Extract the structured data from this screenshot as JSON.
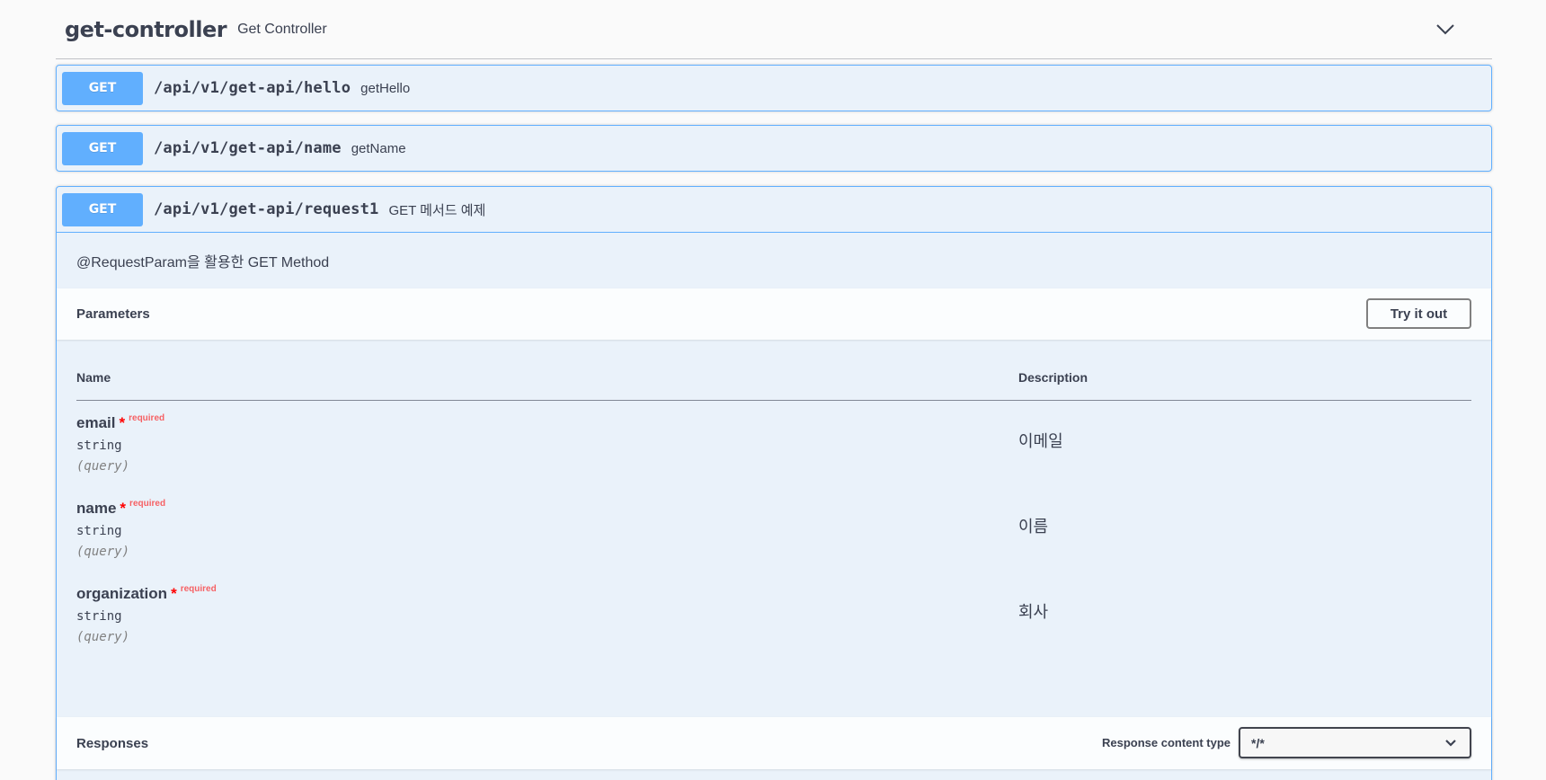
{
  "tag": {
    "name": "get-controller",
    "description": "Get Controller",
    "toggle_icon": "chevron-down-icon"
  },
  "operations": [
    {
      "method": "GET",
      "path": "/api/v1/get-api/hello",
      "summary": "getHello"
    },
    {
      "method": "GET",
      "path": "/api/v1/get-api/name",
      "summary": "getName"
    },
    {
      "method": "GET",
      "path": "/api/v1/get-api/request1",
      "summary": "GET 메서드 예제"
    }
  ],
  "expanded": {
    "description": "@RequestParam을 활용한 GET Method",
    "parameters_title": "Parameters",
    "try_it_out_label": "Try it out",
    "columns": {
      "name": "Name",
      "description": "Description"
    },
    "params": [
      {
        "name": "email",
        "star": "*",
        "required": "required",
        "type": "string",
        "in": "(query)",
        "description": "이메일"
      },
      {
        "name": "name",
        "star": "*",
        "required": "required",
        "type": "string",
        "in": "(query)",
        "description": "이름"
      },
      {
        "name": "organization",
        "star": "*",
        "required": "required",
        "type": "string",
        "in": "(query)",
        "description": "회사"
      }
    ],
    "responses_title": "Responses",
    "response_content_type_label": "Response content type",
    "response_content_type_value": "*/*"
  },
  "colors": {
    "get_accent": "#61affe",
    "text": "#3b4151",
    "required": "#ff0000"
  }
}
